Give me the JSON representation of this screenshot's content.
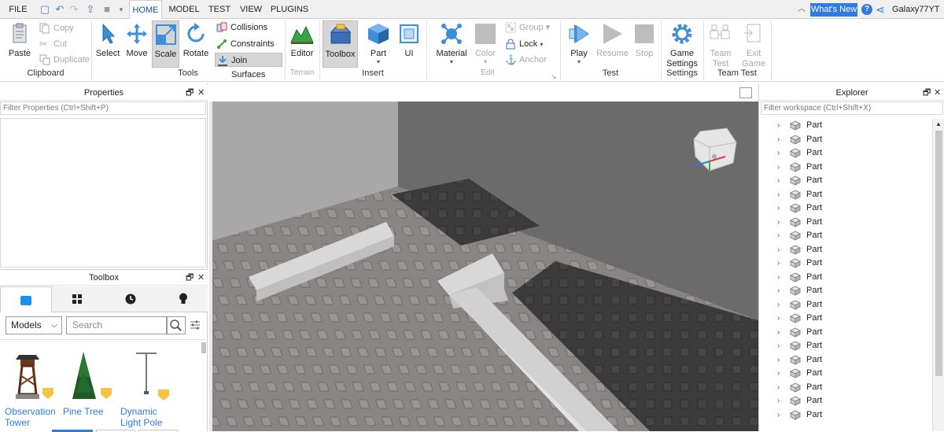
{
  "menu": {
    "file": "FILE",
    "tabs": [
      "HOME",
      "MODEL",
      "TEST",
      "VIEW",
      "PLUGINS"
    ],
    "active_tab": "HOME",
    "whats_new": "What's New",
    "username": "Galaxy77YT"
  },
  "ribbon": {
    "clipboard": {
      "paste": "Paste",
      "copy": "Copy",
      "cut": "Cut",
      "duplicate": "Duplicate",
      "group": "Clipboard"
    },
    "tools": {
      "select": "Select",
      "move": "Move",
      "scale": "Scale",
      "rotate": "Rotate",
      "collisions": "Collisions",
      "constraints": "Constraints",
      "join_surfaces": "Join Surfaces",
      "group": "Tools"
    },
    "terrain": {
      "editor": "Editor",
      "group": "Terrain"
    },
    "insert": {
      "toolbox": "Toolbox",
      "part": "Part",
      "ui": "UI",
      "group": "Insert"
    },
    "edit": {
      "material": "Material",
      "color": "Color",
      "group_btn": "Group",
      "lock": "Lock",
      "anchor": "Anchor",
      "group": "Edit"
    },
    "test": {
      "play": "Play",
      "resume": "Resume",
      "stop": "Stop",
      "group": "Test"
    },
    "settings": {
      "game_settings_1": "Game",
      "game_settings_2": "Settings",
      "group": "Settings"
    },
    "team_test": {
      "team_1": "Team",
      "team_2": "Test",
      "exit_1": "Exit",
      "exit_2": "Game",
      "group": "Team Test"
    }
  },
  "properties": {
    "title": "Properties",
    "filter_placeholder": "Filter Properties (Ctrl+Shift+P)"
  },
  "toolbox": {
    "title": "Toolbox",
    "category": "Models",
    "search_placeholder": "Search",
    "items": [
      {
        "name_1": "Observation",
        "name_2": "Tower"
      },
      {
        "name_1": "Pine Tree",
        "name_2": ""
      },
      {
        "name_1": "Dynamic",
        "name_2": "Light Pole"
      }
    ]
  },
  "explorer": {
    "title": "Explorer",
    "filter_placeholder": "Filter workspace (Ctrl+Shift+X)",
    "items": [
      "Part",
      "Part",
      "Part",
      "Part",
      "Part",
      "Part",
      "Part",
      "Part",
      "Part",
      "Part",
      "Part",
      "Part",
      "Part",
      "Part",
      "Part",
      "Part",
      "Part",
      "Part",
      "Part",
      "Part",
      "Part",
      "Part"
    ]
  },
  "colors": {
    "accent": "#2f7ae5",
    "ribbon_selected": "#d6d6d6",
    "toolbox_tab_active": "#1e90e6"
  },
  "icons": {
    "quick_access": [
      "new-file-icon",
      "undo-icon",
      "redo-icon",
      "publish-icon",
      "stop-square-icon",
      "dropdown-icon"
    ],
    "help": "help-icon",
    "share": "share-icon"
  }
}
